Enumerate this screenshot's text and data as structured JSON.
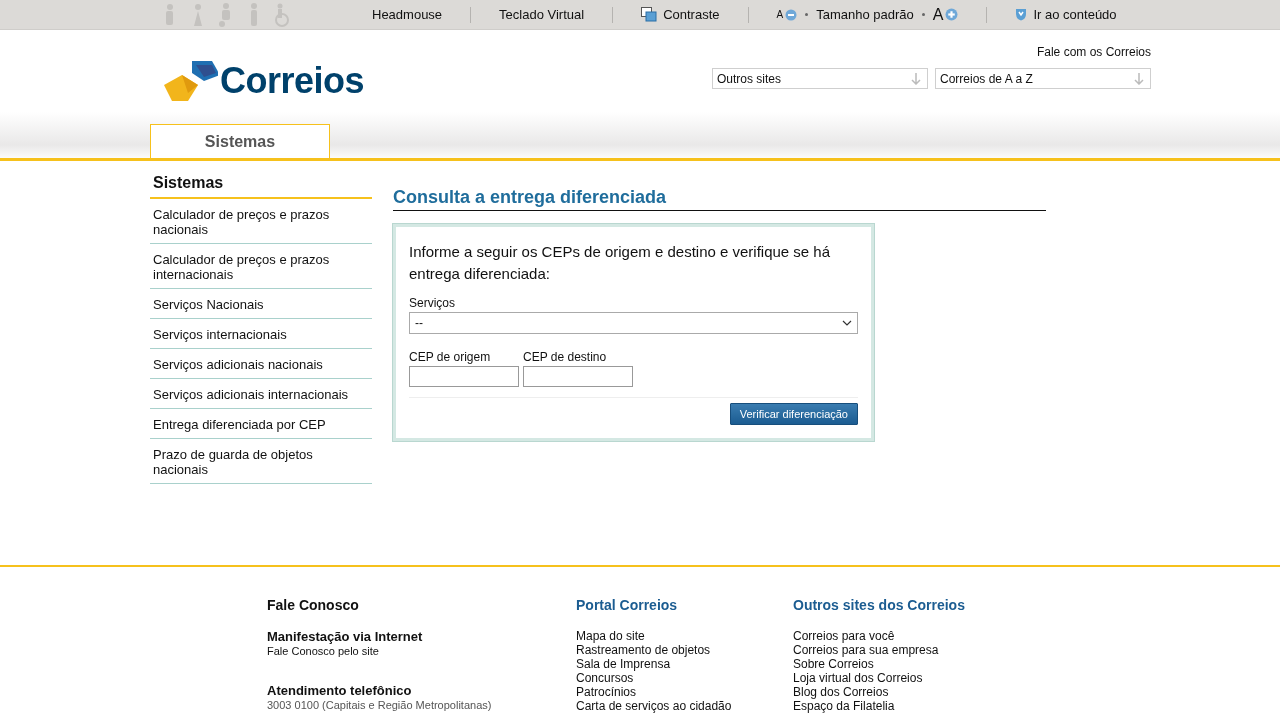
{
  "accessibility_bar": {
    "items": [
      {
        "label": "Headmouse",
        "kind": "text"
      },
      {
        "label": "Teclado Virtual",
        "kind": "text"
      },
      {
        "label": "Contraste",
        "kind": "contrast"
      },
      {
        "label": "Tamanho padrão",
        "kind": "font_size",
        "decrease": "A",
        "increase": "A"
      },
      {
        "label": "Ir ao conteúdo",
        "kind": "skip"
      }
    ]
  },
  "header": {
    "logo": "Correios",
    "contact_link": "Fale com os Correios",
    "dropdowns": [
      {
        "value": "Outros sites"
      },
      {
        "value": "Correios de A a Z"
      }
    ],
    "tabs": [
      {
        "label": "Sistemas",
        "selected": true
      }
    ]
  },
  "sidebar": {
    "title": "Sistemas",
    "items": [
      {
        "label": "Calculador de preços e prazos nacionais",
        "selected": false
      },
      {
        "label": "Calculador de preços e prazos internacionais",
        "selected": false
      },
      {
        "label": "Serviços Nacionais",
        "selected": false
      },
      {
        "label": "Serviços internacionais",
        "selected": false
      },
      {
        "label": "Serviços adicionais nacionais",
        "selected": false
      },
      {
        "label": "Serviços adicionais internacionais",
        "selected": false
      },
      {
        "label": "Entrega diferenciada por CEP",
        "selected": false
      },
      {
        "label": "Prazo de guarda de objetos nacionais",
        "selected": false
      }
    ]
  },
  "main": {
    "title": "Consulta a entrega diferenciada",
    "form": {
      "intro": "Informe a seguir os CEPs de origem e destino e verifique se há entrega diferenciada:",
      "service_label": "Serviços",
      "service_value": "--",
      "origin_label": "CEP de origem",
      "destination_label": "CEP de destino",
      "submit": "Verificar diferenciação"
    }
  },
  "footer": {
    "columns": [
      {
        "title": "Fale Conosco",
        "kind": "contact",
        "sections": [
          {
            "title": "Manifestação via Internet",
            "lines": [
              "Fale Conosco pelo site"
            ]
          },
          {
            "title": "Atendimento telefônico",
            "lines": [
              "3003 0100 (Capitais e Região Metropolitanas)"
            ]
          }
        ]
      },
      {
        "title": "Portal Correios",
        "kind": "links",
        "links": [
          "Mapa do site",
          "Rastreamento de objetos",
          "Sala de Imprensa",
          "Concursos",
          "Patrocínios",
          "Carta de serviços ao cidadão"
        ]
      },
      {
        "title": "Outros sites dos Correios",
        "kind": "links",
        "links": [
          "Correios para você",
          "Correios para sua empresa",
          "Sobre Correios",
          "Loja virtual dos Correios",
          "Blog dos Correios",
          "Espaço da Filatelia"
        ]
      }
    ]
  }
}
